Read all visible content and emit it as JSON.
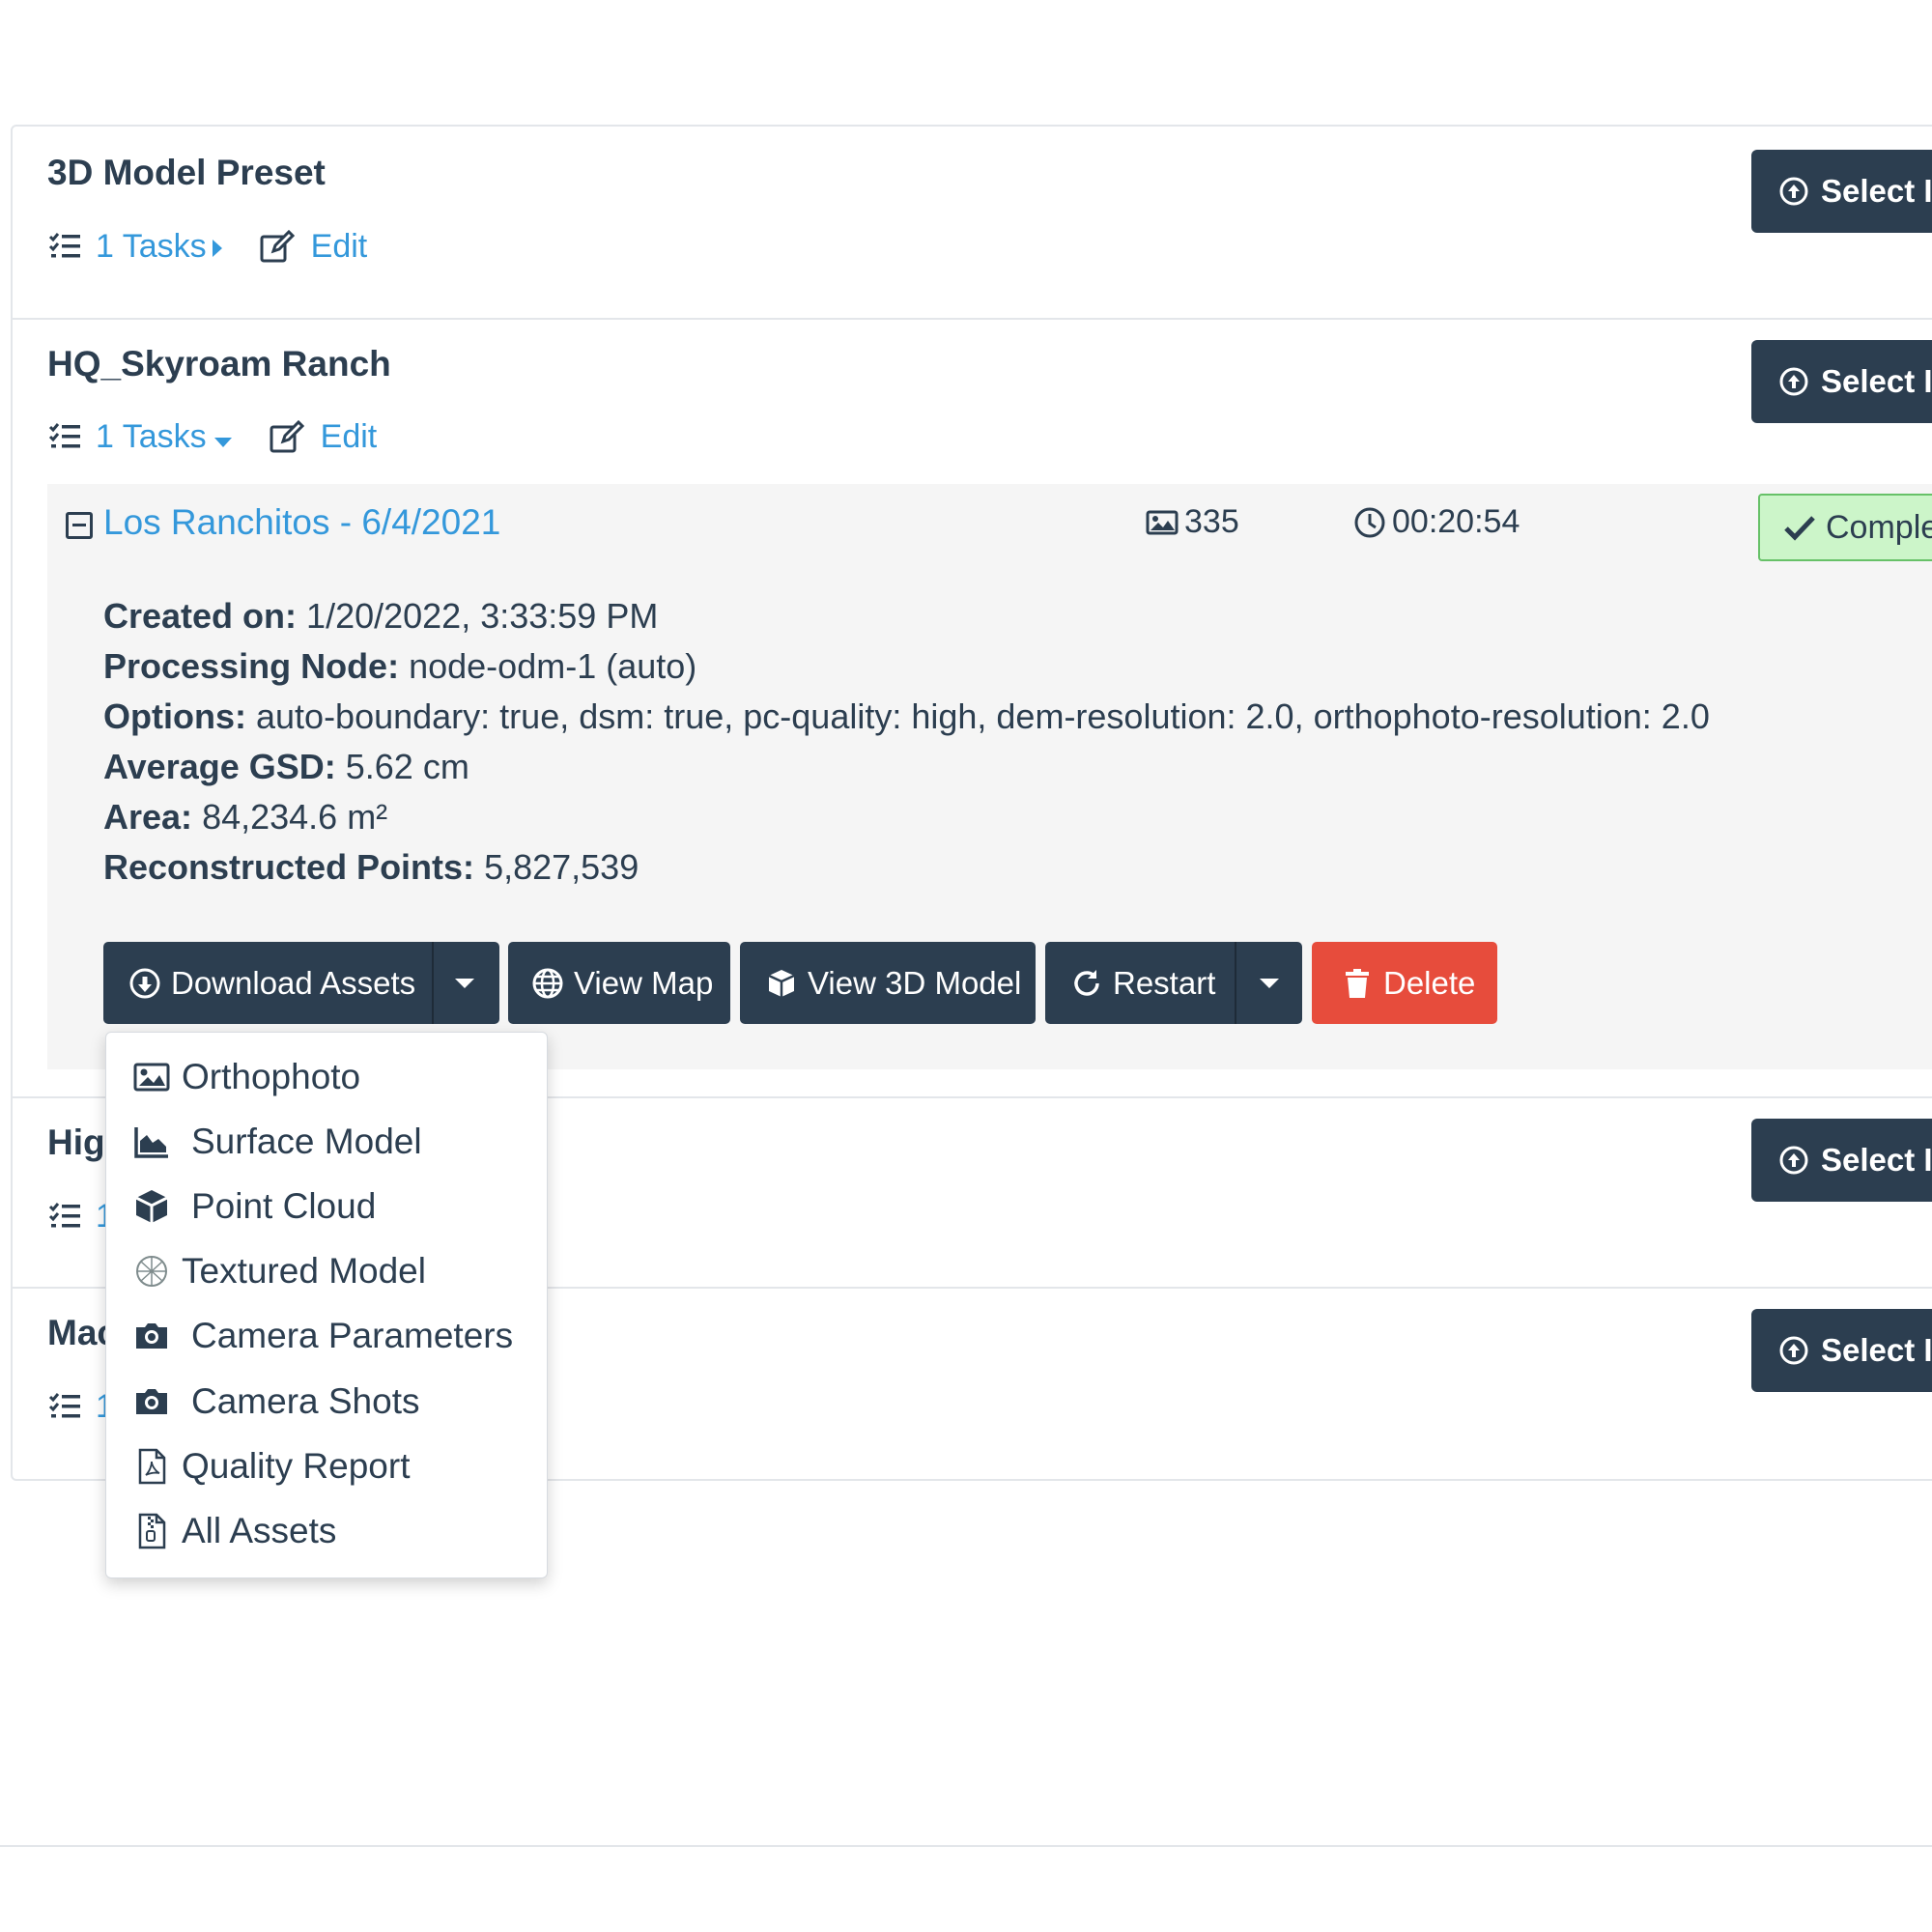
{
  "projects": [
    {
      "name": "3D Model Preset",
      "tasks_label": "1 Tasks",
      "edit_label": "Edit",
      "select_label": "Select Images"
    },
    {
      "name": "HQ_Skyroam Ranch",
      "tasks_label": "1 Tasks",
      "edit_label": "Edit",
      "select_label": "Select Images"
    },
    {
      "name": "Hig",
      "tasks_label": "1",
      "select_label": "Select Images"
    },
    {
      "name": "Mac",
      "tasks_label": "1",
      "select_label": "Select Images"
    }
  ],
  "task": {
    "name": "Los Ranchitos - 6/4/2021",
    "image_count": "335",
    "duration": "00:20:54",
    "status": "Completed",
    "details": {
      "created_label": "Created on:",
      "created_value": "1/20/2022, 3:33:59 PM",
      "node_label": "Processing Node:",
      "node_value": "node-odm-1 (auto)",
      "options_label": "Options:",
      "options_value": "auto-boundary: true, dsm: true, pc-quality: high, dem-resolution: 2.0, orthophoto-resolution: 2.0",
      "gsd_label": "Average GSD:",
      "gsd_value": "5.62 cm",
      "area_label": "Area:",
      "area_value": "84,234.6 m²",
      "points_label": "Reconstructed Points:",
      "points_value": "5,827,539"
    },
    "buttons": {
      "download": "Download Assets",
      "view_map": "View Map",
      "view_3d": "View 3D Model",
      "restart": "Restart",
      "delete": "Delete"
    }
  },
  "download_menu": [
    {
      "label": "Orthophoto",
      "icon": "image-icon"
    },
    {
      "label": "Surface Model",
      "icon": "area-chart-icon"
    },
    {
      "label": "Point Cloud",
      "icon": "cube-icon"
    },
    {
      "label": "Textured Model",
      "icon": "textured-model-icon"
    },
    {
      "label": "Camera Parameters",
      "icon": "camera-icon"
    },
    {
      "label": "Camera Shots",
      "icon": "camera-icon"
    },
    {
      "label": "Quality Report",
      "icon": "pdf-file-icon"
    },
    {
      "label": "All Assets",
      "icon": "zip-file-icon"
    }
  ],
  "colors": {
    "primary": "#2c3e50",
    "link": "#3498db",
    "danger": "#e74c3c",
    "success_bg": "#ccf5c9"
  }
}
